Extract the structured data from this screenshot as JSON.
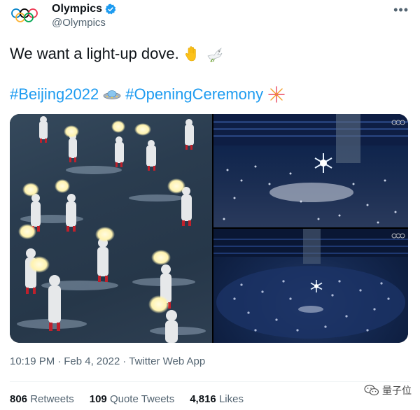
{
  "account": {
    "name": "Olympics",
    "handle": "@Olympics"
  },
  "tweet": {
    "text": "We want a light-up dove.",
    "emojis": [
      "waving-hand",
      "dove"
    ],
    "hashtags": [
      "#Beijing2022",
      "#OpeningCeremony"
    ],
    "hashtag_emojis": [
      "flying-saucer",
      "fireworks"
    ]
  },
  "meta": {
    "time": "10:19 PM",
    "date": "Feb 4, 2022",
    "source": "Twitter Web App",
    "separator": "·"
  },
  "stats": [
    {
      "count": "806",
      "label": "Retweets"
    },
    {
      "count": "109",
      "label": "Quote Tweets"
    },
    {
      "count": "4,816",
      "label": "Likes"
    }
  ],
  "watermark": "量子位",
  "colors": {
    "link": "#1d9bf0",
    "secondary": "#536471",
    "verified": "#1d9bf0"
  }
}
